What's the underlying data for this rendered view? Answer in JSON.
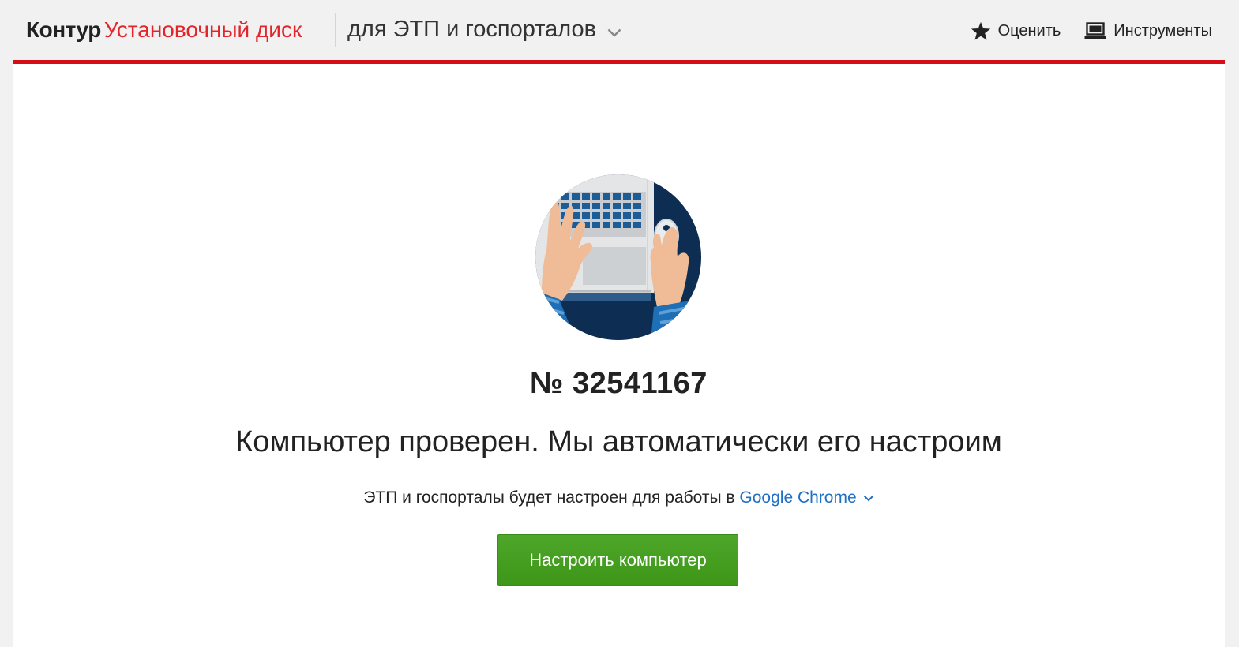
{
  "header": {
    "brand": "Контур",
    "product": "Установочный диск",
    "product_variant": "для ЭТП и госпорталов",
    "actions": {
      "rate_label": "Оценить",
      "tools_label": "Инструменты"
    }
  },
  "main": {
    "disk_number": "№ 32541167",
    "headline": "Компьютер проверен. Мы автоматически его настроим",
    "note_prefix": "ЭТП и госпорталы будет настроен для работы в ",
    "browser": "Google Chrome",
    "configure_button": "Настроить компьютер"
  },
  "colors": {
    "brand_red": "#e3242b",
    "accent_line": "#d70c17",
    "link_blue": "#1f6fc5",
    "button_green": "#45a020"
  },
  "icons": [
    "chevron-down-icon",
    "star-icon",
    "laptop-icon"
  ]
}
